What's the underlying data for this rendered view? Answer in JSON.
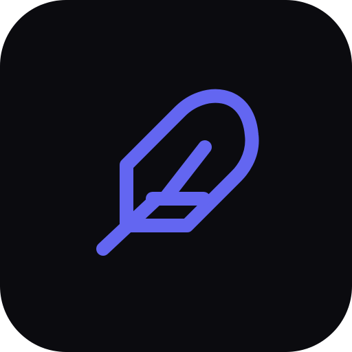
{
  "app_icon": {
    "icon_name": "feather-icon",
    "colors": {
      "background": "#0b0b0f",
      "accent": "#6366f1"
    }
  }
}
